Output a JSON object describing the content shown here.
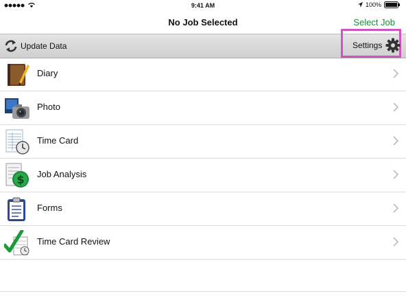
{
  "status": {
    "time": "9:41 AM",
    "battery": "100%"
  },
  "nav": {
    "title": "No Job Selected",
    "select_job": "Select Job"
  },
  "toolbar": {
    "update_label": "Update Data",
    "settings_label": "Settings"
  },
  "menu": [
    {
      "label": "Diary",
      "icon": "diary-icon"
    },
    {
      "label": "Photo",
      "icon": "camera-icon"
    },
    {
      "label": "Time Card",
      "icon": "timecard-icon"
    },
    {
      "label": "Job Analysis",
      "icon": "dollar-icon"
    },
    {
      "label": "Forms",
      "icon": "clipboard-icon"
    },
    {
      "label": "Time Card Review",
      "icon": "checkmark-icon"
    }
  ],
  "colors": {
    "accent": "#1b8a3c",
    "highlight": "#d155c0",
    "toolbar": "#d6d6d6"
  }
}
